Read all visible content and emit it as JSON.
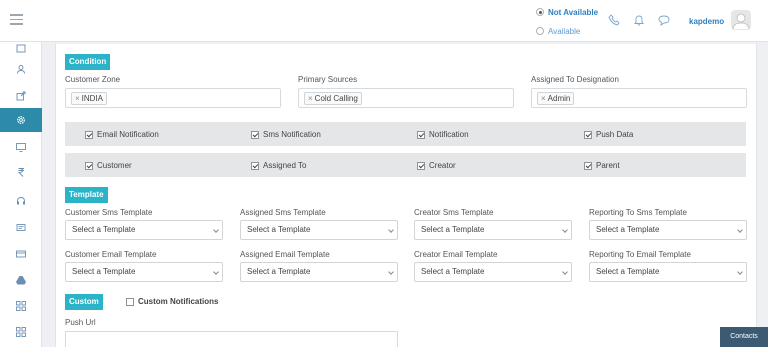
{
  "header": {
    "status_options": [
      {
        "label": "Not Available",
        "selected": true
      },
      {
        "label": "Available",
        "selected": false
      }
    ],
    "icons": [
      "phone-icon",
      "bell-icon",
      "chat-icon"
    ],
    "user_name": "kapdemo"
  },
  "sidebar": {
    "items": [
      "calendar-icon",
      "users-icon",
      "export-icon",
      "settings-icon",
      "monitor-icon",
      "rupee-icon",
      "headset-icon",
      "message-icon",
      "card-icon",
      "drive-icon",
      "grid-icon",
      "apps-icon"
    ],
    "active": "settings-icon",
    "accent": "#2d8aa8"
  },
  "condition": {
    "title": "Condition",
    "customer_zone": {
      "label": "Customer Zone",
      "tags": [
        "INDIA"
      ]
    },
    "primary_sources": {
      "label": "Primary Sources",
      "tags": [
        "Cold Calling"
      ]
    },
    "assigned_designation": {
      "label": "Assigned To Designation",
      "tags": [
        "Admin"
      ]
    }
  },
  "checkboxes": {
    "row1": [
      {
        "label": "Email Notification",
        "checked": true
      },
      {
        "label": "Sms Notification",
        "checked": true
      },
      {
        "label": "Notification",
        "checked": true
      },
      {
        "label": "Push Data",
        "checked": true
      }
    ],
    "row2": [
      {
        "label": "Customer",
        "checked": true
      },
      {
        "label": "Assigned To",
        "checked": true
      },
      {
        "label": "Creator",
        "checked": true
      },
      {
        "label": "Parent",
        "checked": true
      }
    ]
  },
  "template": {
    "title": "Template",
    "sms": [
      {
        "label": "Customer Sms Template",
        "value": "Select a Template"
      },
      {
        "label": "Assigned Sms Template",
        "value": "Select a Template"
      },
      {
        "label": "Creator Sms Template",
        "value": "Select a Template"
      },
      {
        "label": "Reporting To Sms Template",
        "value": "Select a Template"
      }
    ],
    "email": [
      {
        "label": "Customer Email Template",
        "value": "Select a Template"
      },
      {
        "label": "Assigned Email Template",
        "value": "Select a Template"
      },
      {
        "label": "Creator Email Template",
        "value": "Select a Template"
      },
      {
        "label": "Reporting To Email Template",
        "value": "Select a Template"
      }
    ]
  },
  "custom": {
    "title": "Custom",
    "custom_notifications_label": "Custom Notifications",
    "custom_notifications_checked": false,
    "push_url_label": "Push Url",
    "push_url_value": ""
  },
  "contacts_button": "Contacts",
  "colors": {
    "tag_bg": "#2bb3c8",
    "link": "#2f7fc1"
  }
}
